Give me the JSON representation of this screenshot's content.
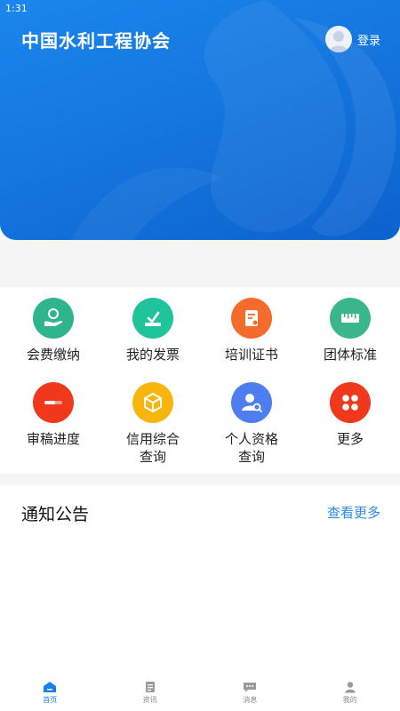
{
  "status_bar": {
    "time": "1:31"
  },
  "header": {
    "title": "中国水利工程协会",
    "login_label": "登录"
  },
  "grid": {
    "items": [
      {
        "label": "会费缴纳",
        "icon": "hand-coin-icon",
        "color": "#2fb58d"
      },
      {
        "label": "我的发票",
        "icon": "invoice-icon",
        "color": "#1fc49a"
      },
      {
        "label": "培训证书",
        "icon": "certificate-icon",
        "color": "#f56b2c"
      },
      {
        "label": "团体标准",
        "icon": "ruler-icon",
        "color": "#3bb68a"
      },
      {
        "label": "审稿进度",
        "icon": "progress-icon",
        "color": "#f0391c"
      },
      {
        "label": "信用综合\n查询",
        "icon": "cube-icon",
        "color": "#f8b60d"
      },
      {
        "label": "个人资格\n查询",
        "icon": "person-search-icon",
        "color": "#4e7df1"
      },
      {
        "label": "更多",
        "icon": "more-icon",
        "color": "#f0391c"
      }
    ]
  },
  "notice": {
    "title": "通知公告",
    "more_label": "查看更多"
  },
  "tabbar": {
    "tabs": [
      {
        "label": "首页",
        "icon": "home-icon",
        "active": true
      },
      {
        "label": "资讯",
        "icon": "news-icon",
        "active": false
      },
      {
        "label": "消息",
        "icon": "message-icon",
        "active": false
      },
      {
        "label": "我的",
        "icon": "profile-icon",
        "active": false
      }
    ]
  },
  "colors": {
    "primary": "#1577e0",
    "accent_link": "#2a8be8"
  }
}
